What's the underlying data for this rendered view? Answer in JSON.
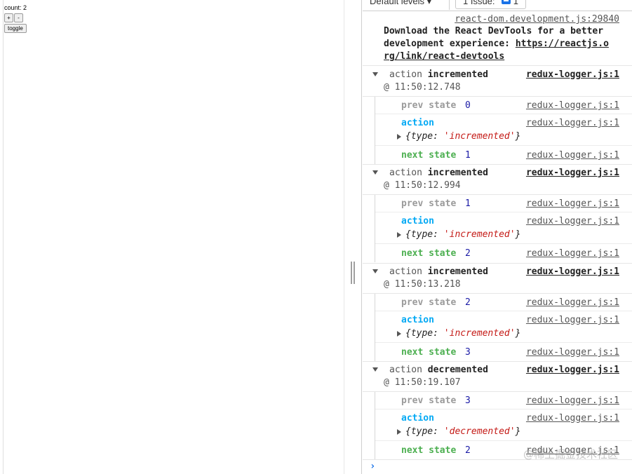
{
  "app": {
    "count_text": "count: 2",
    "inc_label": "+",
    "dec_label": "-",
    "toggle_label": "toggle"
  },
  "toolbar": {
    "levels_label": "Default levels ▾",
    "issues_label": "1 Issue:",
    "issues_count": "1"
  },
  "console": {
    "intro": {
      "source": "react-dom.development.js:29840",
      "line1": "Download the React DevTools for a better",
      "line2_text": "development experience: ",
      "line2_link": "https://reactjs.o",
      "line3_link": "rg/link/react-devtools"
    },
    "logger_source": "redux-logger.js:1",
    "prev_label": "prev state",
    "action_label": "action",
    "next_label": "next state",
    "type_key": "type:",
    "groups": [
      {
        "prefix": "action",
        "name": "incremented",
        "time": "@ 11:50:12.748",
        "prev": "0",
        "type_value": "'incremented'",
        "next": "1"
      },
      {
        "prefix": "action",
        "name": "incremented",
        "time": "@ 11:50:12.994",
        "prev": "1",
        "type_value": "'incremented'",
        "next": "2"
      },
      {
        "prefix": "action",
        "name": "incremented",
        "time": "@ 11:50:13.218",
        "prev": "2",
        "type_value": "'incremented'",
        "next": "3"
      },
      {
        "prefix": "action",
        "name": "decremented",
        "time": "@ 11:50:19.107",
        "prev": "3",
        "type_value": "'decremented'",
        "next": "2"
      }
    ],
    "prompt": "›"
  },
  "watermark": "@稀土掘金技术社区",
  "colors": {
    "prev_label": "#9a9a9a",
    "action_label": "#03a9f4",
    "next_label": "#4caf50",
    "number": "#1a1aa6",
    "string": "#c41a16",
    "issue_badge": "#1a73e8"
  }
}
